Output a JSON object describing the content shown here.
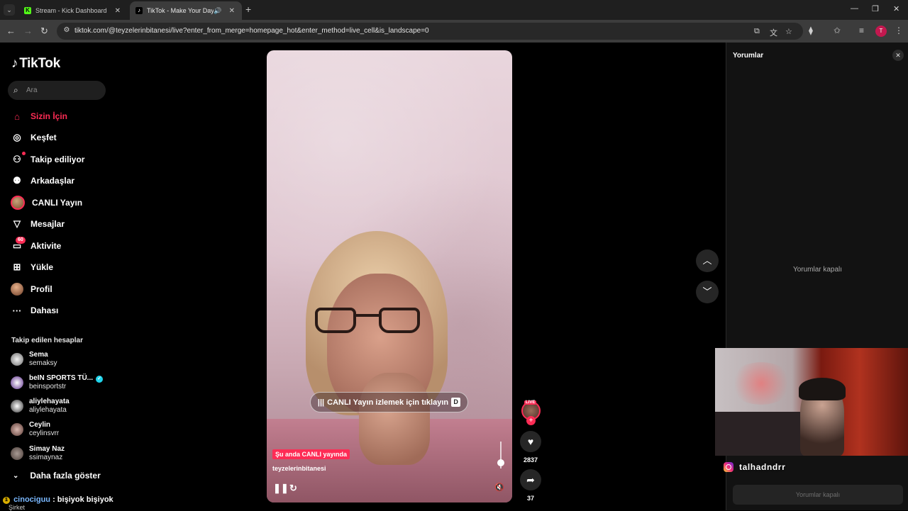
{
  "browser": {
    "tabs": [
      {
        "title": "Stream - Kick Dashboard",
        "favicon": "K"
      },
      {
        "title": "TikTok - Make Your Day",
        "favicon": "♪"
      }
    ],
    "url": "tiktok.com/@teyzelerinbitanesi/live?enter_from_merge=homepage_hot&enter_method=live_cell&is_landscape=0",
    "profile_initial": "T"
  },
  "sidebar": {
    "brand": "TikTok",
    "search_placeholder": "Ara",
    "nav": [
      {
        "label": "Sizin İçin",
        "icon": "home-icon"
      },
      {
        "label": "Keşfet",
        "icon": "compass-icon"
      },
      {
        "label": "Takip ediliyor",
        "icon": "following-icon"
      },
      {
        "label": "Arkadaşlar",
        "icon": "friends-icon"
      },
      {
        "label": "CANLI Yayın",
        "icon": "live-avatar-icon"
      },
      {
        "label": "Mesajlar",
        "icon": "send-icon"
      },
      {
        "label": "Aktivite",
        "icon": "activity-icon",
        "badge": "60"
      },
      {
        "label": "Yükle",
        "icon": "upload-icon"
      },
      {
        "label": "Profil",
        "icon": "profile-avatar-icon"
      },
      {
        "label": "Dahası",
        "icon": "more-icon"
      }
    ],
    "following_heading": "Takip edilen hesaplar",
    "accounts": [
      {
        "name": "Sema",
        "username": "semaksy"
      },
      {
        "name": "beIN SPORTS TÜ...",
        "username": "beinsportstr",
        "verified": true
      },
      {
        "name": "aliylehayata",
        "username": "aliylehayata"
      },
      {
        "name": "Ceylin",
        "username": "ceylinsvrr"
      },
      {
        "name": "Simay Naz",
        "username": "ssimaynaz"
      }
    ],
    "show_more": "Daha fazla göster"
  },
  "chat_overlay": {
    "user": "cinociguu",
    "message": ": bişiyok bişiyok",
    "sub": "Şirket"
  },
  "video": {
    "cta": "CANLI Yayın izlemek için tıklayın",
    "cta_key": "D",
    "live_tag": "Şu anda CANLI yayında",
    "creator": "teyzelerinbitanesi",
    "volume_level": 0.2
  },
  "rail": {
    "live_label": "LIVE",
    "like_count": "2837",
    "share_count": "37"
  },
  "comments": {
    "title": "Yorumlar",
    "disabled_text": "Yorumlar kapalı",
    "input_disabled_text": "Yorumlar kapalı"
  },
  "webcam": {
    "instagram_handle": "talhadndrr"
  },
  "colors": {
    "accent": "#fe2c55",
    "kick_green": "#53fc18",
    "verified": "#20d5ec"
  }
}
